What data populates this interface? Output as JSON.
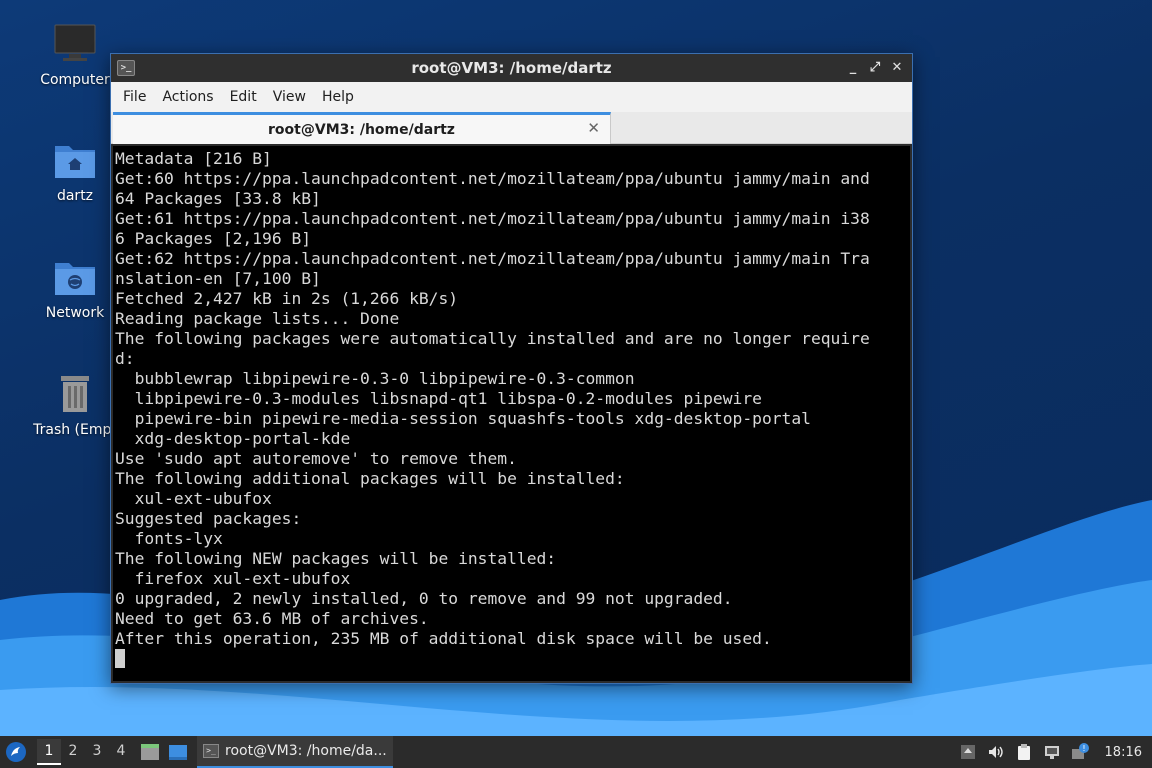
{
  "desktop": {
    "icons": [
      {
        "label": "Computer",
        "icon": "monitor-icon"
      },
      {
        "label": "dartz",
        "icon": "home-folder-icon"
      },
      {
        "label": "Network",
        "icon": "network-folder-icon"
      },
      {
        "label": "Trash (Empt",
        "icon": "trash-icon"
      }
    ]
  },
  "window": {
    "title": "root@VM3: /home/dartz",
    "menu": [
      "File",
      "Actions",
      "Edit",
      "View",
      "Help"
    ],
    "tab_title": "root@VM3: /home/dartz",
    "controls": {
      "minimize": "_",
      "maximize": "⤢",
      "close": "✕"
    }
  },
  "terminal": {
    "lines": [
      "Metadata [216 B]",
      "Get:60 https://ppa.launchpadcontent.net/mozillateam/ppa/ubuntu jammy/main and",
      "64 Packages [33.8 kB]",
      "Get:61 https://ppa.launchpadcontent.net/mozillateam/ppa/ubuntu jammy/main i38",
      "6 Packages [2,196 B]",
      "Get:62 https://ppa.launchpadcontent.net/mozillateam/ppa/ubuntu jammy/main Tra",
      "nslation-en [7,100 B]",
      "Fetched 2,427 kB in 2s (1,266 kB/s)",
      "Reading package lists... Done",
      "The following packages were automatically installed and are no longer require",
      "d:",
      "  bubblewrap libpipewire-0.3-0 libpipewire-0.3-common",
      "  libpipewire-0.3-modules libsnapd-qt1 libspa-0.2-modules pipewire",
      "  pipewire-bin pipewire-media-session squashfs-tools xdg-desktop-portal",
      "  xdg-desktop-portal-kde",
      "Use 'sudo apt autoremove' to remove them.",
      "The following additional packages will be installed:",
      "  xul-ext-ubufox",
      "Suggested packages:",
      "  fonts-lyx",
      "The following NEW packages will be installed:",
      "  firefox xul-ext-ubufox",
      "0 upgraded, 2 newly installed, 0 to remove and 99 not upgraded.",
      "Need to get 63.6 MB of archives.",
      "After this operation, 235 MB of additional disk space will be used."
    ]
  },
  "taskbar": {
    "workspaces": [
      "1",
      "2",
      "3",
      "4"
    ],
    "active_workspace": "1",
    "task_label": "root@VM3: /home/da...",
    "clock": "18:16"
  },
  "colors": {
    "accent": "#3d8ee0",
    "terminal_bg": "#000000",
    "terminal_fg": "#d9d9d9"
  }
}
